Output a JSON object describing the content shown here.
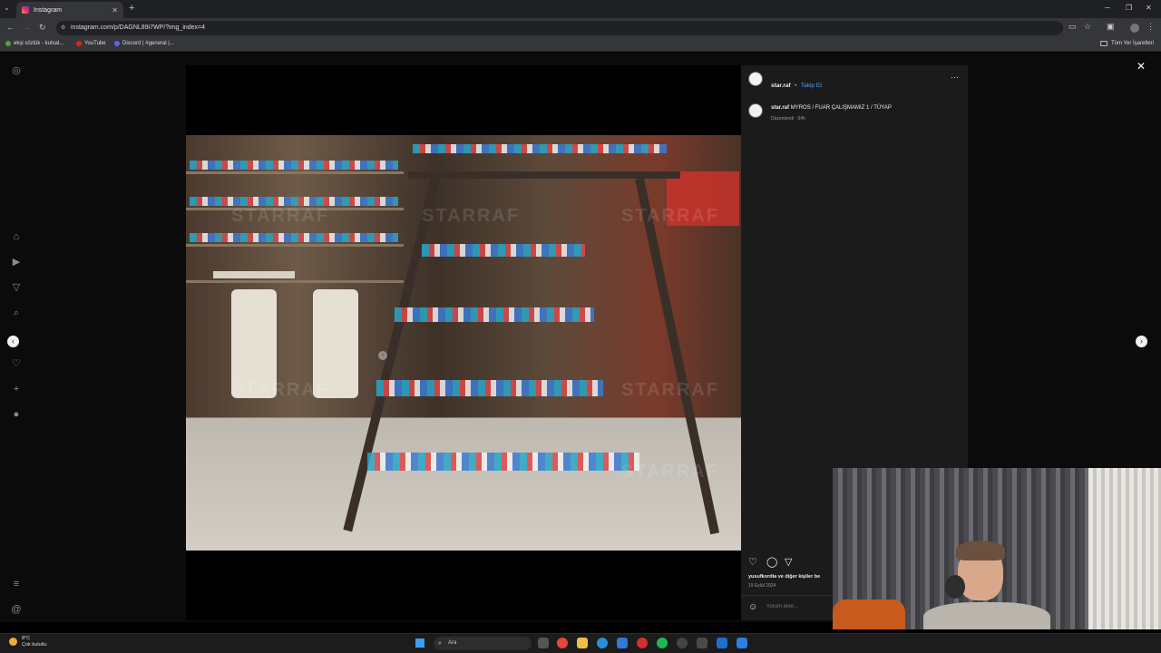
{
  "browser": {
    "tab_title": "Instagram",
    "url": "instagram.com/p/DAGNL89i7WP/?img_index=4",
    "bookmarks": [
      {
        "label": "ekşi sözlük - kutsal...",
        "color": "#5a9e3a"
      },
      {
        "label": "YouTube",
        "color": "#e62117"
      },
      {
        "label": "Discord | #general |...",
        "color": "#5865f2"
      }
    ],
    "bookmarks_right": "Tüm Yer İşaretleri"
  },
  "post": {
    "username": "star.raf",
    "follow_label": "Takip Et",
    "separator": "•",
    "caption_user": "star.raf",
    "caption_text": "MYROS / FUAR ÇALIŞMAMIZ 1 / TÜYAP",
    "edited": "Düzenlendi · 54h",
    "likes": "yusufkordia ve diğer kişiler be",
    "date": "19 Eylül 2024",
    "comment_placeholder": "Yorum ekle..."
  },
  "photo": {
    "watermark": "STARRAF"
  },
  "taskbar": {
    "weather_temp": "8°C",
    "weather_desc": "Çok bulutlu",
    "search_label": "Ara"
  },
  "icons": {
    "sidebar": [
      "instagram-icon",
      "home-icon",
      "reels-icon",
      "send-icon",
      "search-icon",
      "heart-icon",
      "create-icon",
      "profile-icon",
      "menu-icon",
      "threads-icon"
    ],
    "post_actions": [
      "heart-icon",
      "comment-icon",
      "share-icon"
    ]
  }
}
